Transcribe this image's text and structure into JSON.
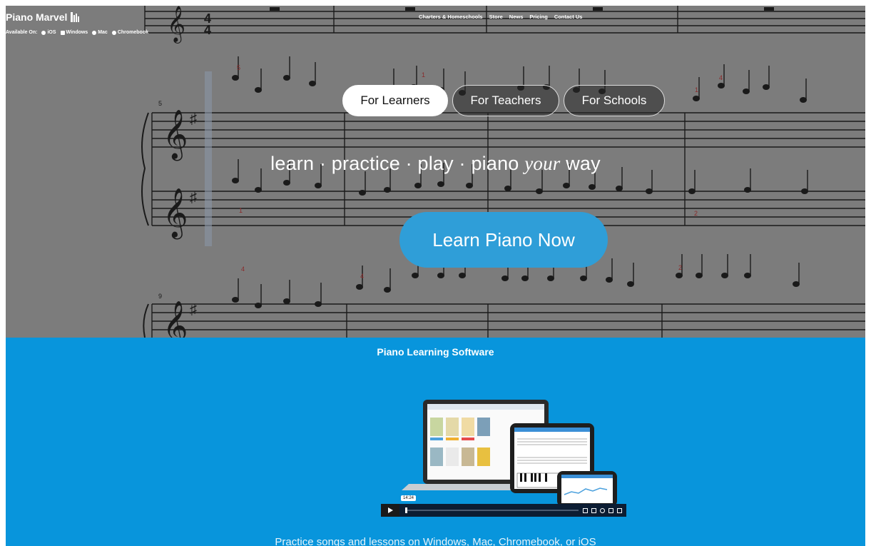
{
  "brand": {
    "name": "Piano Marvel"
  },
  "available": {
    "label": "Available On:",
    "platforms": [
      "iOS",
      "Windows",
      "Mac",
      "Chromebook"
    ]
  },
  "nav": {
    "items": [
      "Charters & Homeschools",
      "Store",
      "News",
      "Pricing",
      "Contact Us"
    ]
  },
  "tabs": [
    {
      "label": "For Learners",
      "active": true
    },
    {
      "label": "For Teachers",
      "active": false
    },
    {
      "label": "For Schools",
      "active": false
    }
  ],
  "tagline": {
    "before": "learn · practice · play · piano ",
    "emphasis": "your",
    "after": " way"
  },
  "cta": {
    "label": "Learn Piano Now"
  },
  "section": {
    "title": "Piano Learning Software",
    "subtitle": "Practice songs and lessons on Windows, Mac, Chromebook, or iOS"
  },
  "video": {
    "time": "14:24"
  },
  "sheet_music": {
    "measure_numbers": [
      "5",
      "9"
    ],
    "fingerings": [
      "5",
      "1",
      "4",
      "1",
      "1",
      "2",
      "4",
      "4",
      "2"
    ],
    "time_signature": [
      "4",
      "4"
    ]
  },
  "colors": {
    "hero_overlay": "#7c7c7c",
    "cta": "#2f9ed8",
    "section_bg": "#0895dc"
  }
}
